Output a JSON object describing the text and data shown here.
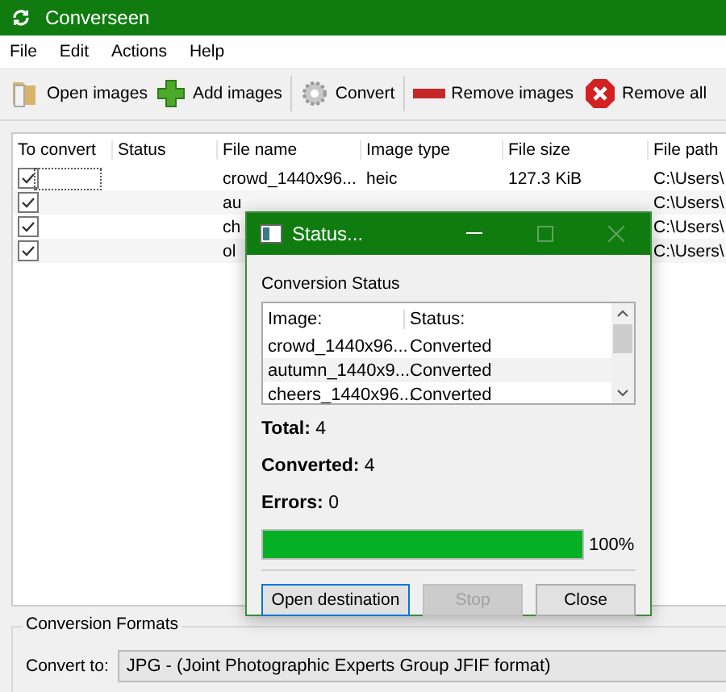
{
  "window": {
    "title": "Converseen"
  },
  "menu": [
    "File",
    "Edit",
    "Actions",
    "Help"
  ],
  "toolbar": [
    {
      "kind": "open",
      "label": "Open images"
    },
    {
      "kind": "add",
      "label": "Add images"
    },
    {
      "kind": "convert",
      "label": "Convert"
    },
    {
      "kind": "remove",
      "label": "Remove images"
    },
    {
      "kind": "remove_all",
      "label": "Remove all"
    }
  ],
  "table": {
    "columns": [
      "To convert",
      "Status",
      "File name",
      "Image type",
      "File size",
      "File path"
    ],
    "rows": [
      {
        "checked": true,
        "file_name": "crowd_1440x96...",
        "image_type": "heic",
        "file_size": "127.3 KiB",
        "file_path": "C:\\Users\\"
      },
      {
        "checked": true,
        "file_name": "au",
        "file_path": "C:\\Users\\"
      },
      {
        "checked": true,
        "file_name": "ch",
        "file_path": "C:\\Users\\"
      },
      {
        "checked": true,
        "file_name": "ol",
        "file_path": "C:\\Users\\"
      }
    ]
  },
  "dialog": {
    "title": "Status...",
    "section": "Conversion Status",
    "list": {
      "columns": [
        "Image:",
        "Status:"
      ],
      "rows": [
        {
          "image": "crowd_1440x96...",
          "status": "Converted"
        },
        {
          "image": "autumn_1440x9...",
          "status": "Converted"
        },
        {
          "image": "cheers_1440x96...",
          "status": "Converted"
        }
      ]
    },
    "stats": [
      {
        "label": "Total:",
        "value": "4"
      },
      {
        "label": "Converted:",
        "value": "4"
      },
      {
        "label": "Errors:",
        "value": "0"
      }
    ],
    "progress": {
      "level": 1,
      "reading": "100%"
    },
    "buttons": [
      {
        "label": "Open destination",
        "disabled": false
      },
      {
        "label": "Stop",
        "disabled": true
      },
      {
        "label": "Close",
        "disabled": false
      }
    ]
  },
  "formats": {
    "title": "Conversion Formats",
    "label": "Convert to:",
    "value": "JPG - (Joint Photographic Experts Group JFIF format)"
  }
}
